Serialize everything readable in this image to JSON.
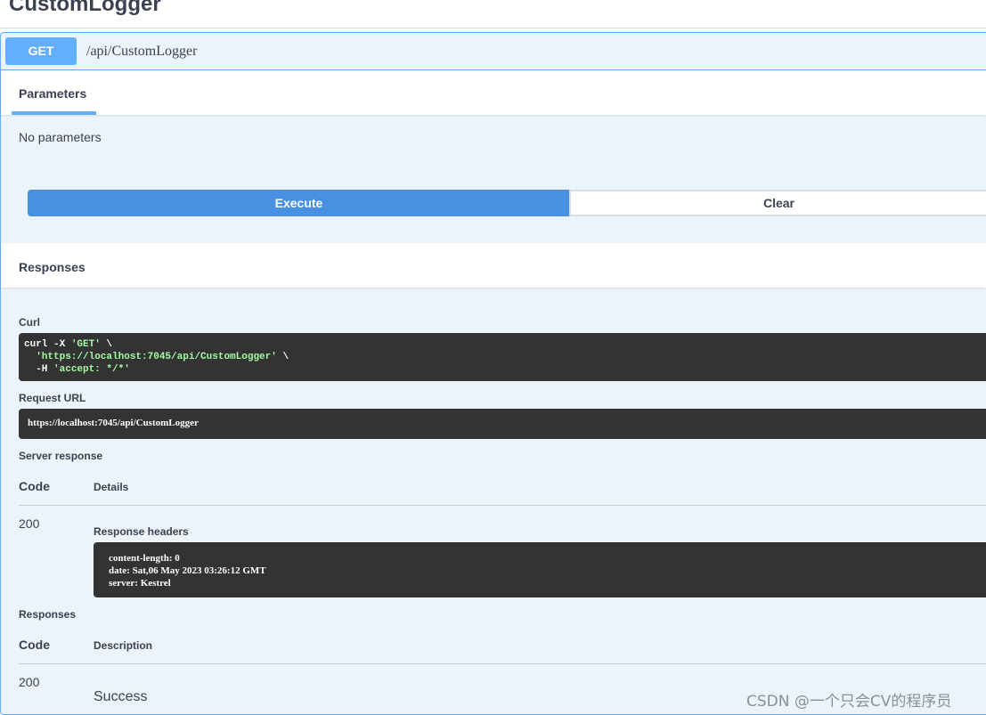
{
  "tag": {
    "title": "CustomLogger"
  },
  "operation": {
    "method": "GET",
    "path": "/api/CustomLogger",
    "method_color": "#61affe"
  },
  "parameters": {
    "tab_label": "Parameters",
    "empty_text": "No parameters"
  },
  "actions": {
    "execute_label": "Execute",
    "clear_label": "Clear",
    "execute_color": "#4990e2"
  },
  "responses_section": {
    "title": "Responses"
  },
  "curl": {
    "label": "Curl",
    "cmd": "curl -X ",
    "method_str": "'GET'",
    "cont1": " \\",
    "url_str": "'https://localhost:7045/api/CustomLogger'",
    "cont2": " \\",
    "header_flag": "-H ",
    "header_str": "'accept: */*'"
  },
  "request_url": {
    "label": "Request URL",
    "value": "https://localhost:7045/api/CustomLogger"
  },
  "server_response": {
    "label": "Server response",
    "col_code": "Code",
    "col_details": "Details",
    "code": "200",
    "headers_label": "Response headers",
    "headers": [
      "content-length: 0",
      "date: Sat,06 May 2023 03:26:12 GMT",
      "server: Kestrel"
    ]
  },
  "documented_responses": {
    "label": "Responses",
    "col_code": "Code",
    "col_description": "Description",
    "code": "200",
    "description": "Success"
  },
  "watermark": {
    "text": "CSDN @一个只会CV的程序员"
  }
}
